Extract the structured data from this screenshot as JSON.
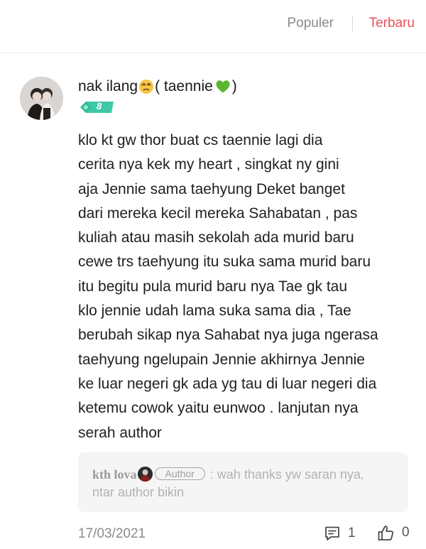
{
  "sort": {
    "popular_label": "Populer",
    "newest_label": "Terbaru",
    "active": "Terbaru",
    "active_color": "#e8505b"
  },
  "comment": {
    "username_part1": "nak ilang",
    "username_part2": "( taennie ",
    "username_part3": ")",
    "username_emoji_1": "unamused-face-icon",
    "username_emoji_2": "green-heart-icon",
    "level": "8",
    "level_badge_color": "#3fc9a6",
    "text_lines": [
      "klo kt gw thor buat cs taennie lagi dia",
      "cerita nya kek my heart , singkat ny gini",
      "aja Jennie sama taehyung Deket banget",
      "dari mereka kecil mereka Sahabatan , pas",
      "kuliah atau masih sekolah ada murid baru",
      "cewe trs taehyung itu suka sama murid baru",
      "itu begitu pula murid baru nya Tae gk tau",
      "klo jennie udah lama suka sama dia , Tae",
      "berubah sikap nya Sahabat nya juga ngerasa",
      "taehyung ngelupain Jennie akhirnya Jennie",
      "ke luar negeri gk ada yg tau di luar negeri dia",
      "ketemu cowok yaitu eunwoo . lanjutan nya",
      "serah author"
    ],
    "date": "17/03/2021",
    "reply_count": "1",
    "like_count": "0"
  },
  "reply": {
    "author_name": "kth lova",
    "author_tag": "Author",
    "separator": " : ",
    "text_line1": "wah thanks yw saran nya,",
    "text_line2": "ntar author bikin"
  }
}
